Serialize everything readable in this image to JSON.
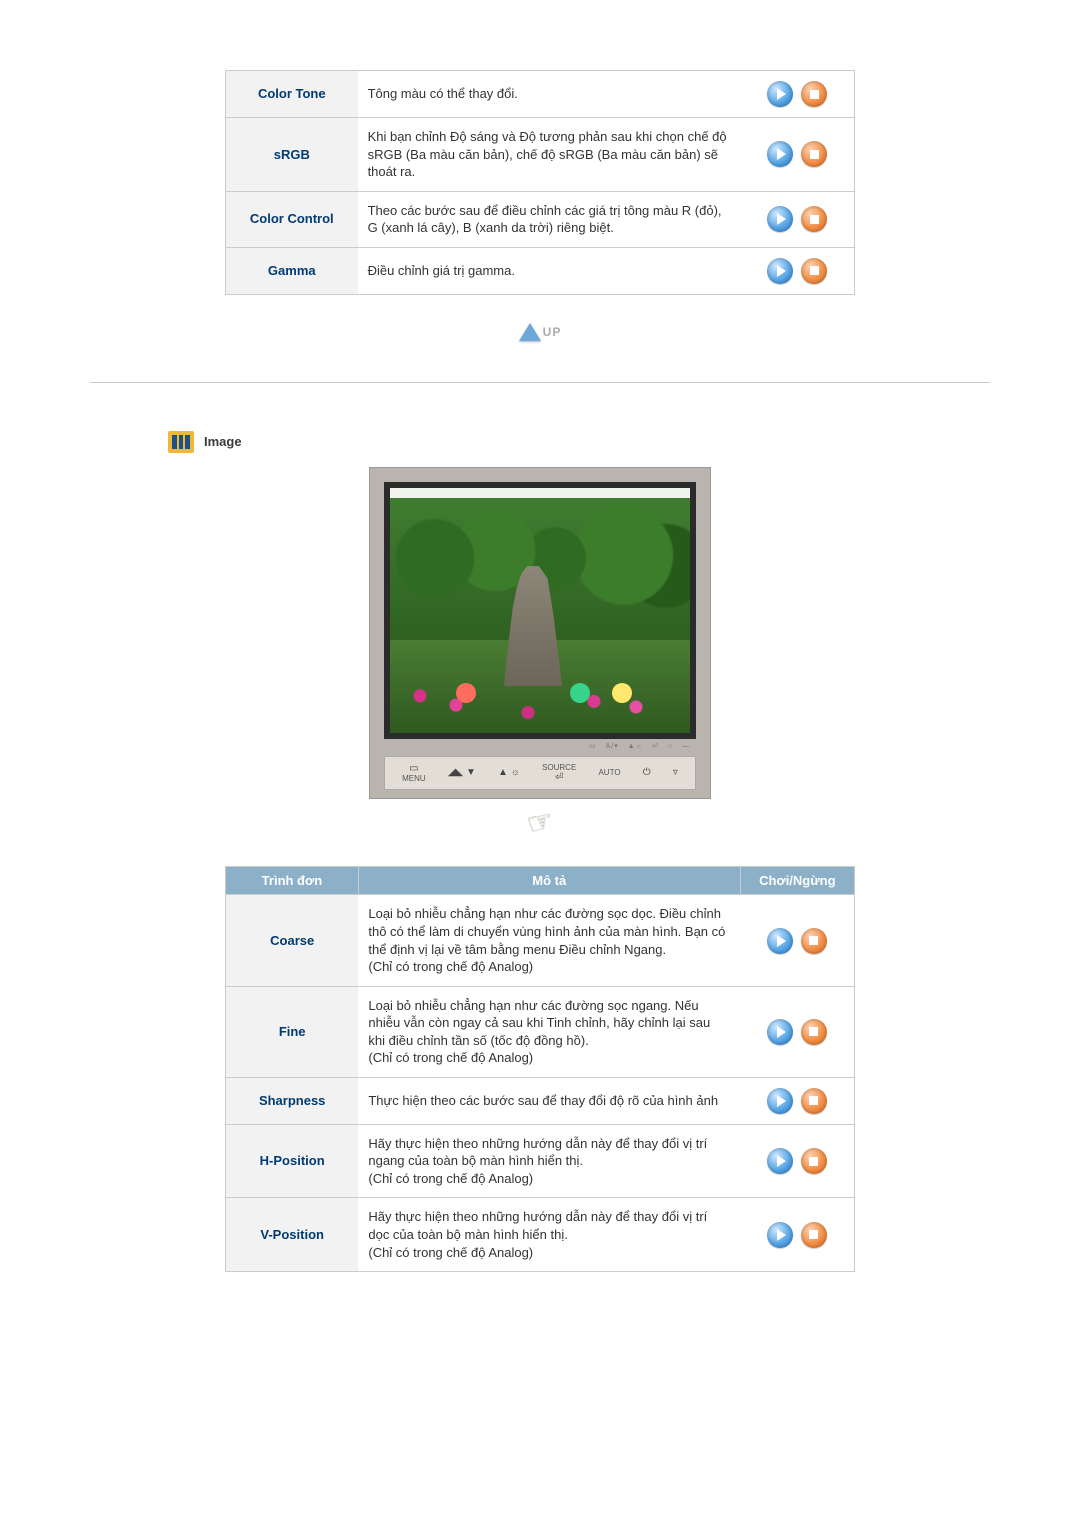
{
  "top_table": {
    "rows": [
      {
        "label": "Color Tone",
        "desc": "Tông màu có thể thay đổi."
      },
      {
        "label": "sRGB",
        "desc": "Khi bạn chỉnh Độ sáng và Độ tương phản sau khi chọn chế độ sRGB (Ba màu căn bản), chế độ sRGB (Ba màu căn bản) sẽ thoát ra."
      },
      {
        "label": "Color Control",
        "desc": "Theo các bước sau để điều chỉnh các giá trị tông màu R (đỏ), G (xanh lá cây), B (xanh da trời) riêng biệt."
      },
      {
        "label": "Gamma",
        "desc": "Điều chỉnh giá trị gamma."
      }
    ]
  },
  "up_label": "UP",
  "section_title": "Image",
  "monitor": {
    "indicator1": "▭",
    "indicator2": "A/▾",
    "indicator3": "▲☼",
    "indicator4": "⏎",
    "indicator5": "○",
    "indicator6": "—",
    "buttons": {
      "menu_sym": "▭",
      "menu": "MENU",
      "down_sym": "◢◣ ▼",
      "up_sym": "▲ ☼",
      "source_top": "SOURCE",
      "source_sym": "⏎",
      "auto": "AUTO",
      "power": "⏻",
      "misc": "▿"
    }
  },
  "image_table": {
    "headers": {
      "menu": "Trình đơn",
      "desc": "Mô tả",
      "play": "Chơi/Ngừng"
    },
    "rows": [
      {
        "label": "Coarse",
        "desc": "Loại bỏ nhiễu chẳng hạn như các đường sọc dọc. Điều chỉnh thô có thể làm di chuyển vùng hình ảnh của màn hình. Bạn có thể định vị lại về tâm bằng menu Điều chỉnh Ngang.\n(Chỉ có trong chế độ Analog)"
      },
      {
        "label": "Fine",
        "desc": "Loại bỏ nhiễu chẳng hạn như các đường sọc ngang. Nếu nhiễu vẫn còn ngay cả sau khi Tinh chỉnh, hãy chỉnh lại sau khi điều chỉnh tần số (tốc độ đồng hồ).\n(Chỉ có trong chế độ Analog)"
      },
      {
        "label": "Sharpness",
        "desc": "Thực hiện theo các bước sau để thay đổi độ rõ của hình ảnh"
      },
      {
        "label": "H-Position",
        "desc": "Hãy thực hiện theo những hướng dẫn này để thay đổi vị trí ngang của toàn bộ màn hình hiển thị.\n(Chỉ có trong chế độ Analog)"
      },
      {
        "label": "V-Position",
        "desc": "Hãy thực hiện theo những hướng dẫn này để thay đổi vị trí dọc của toàn bộ màn hình hiển thị.\n(Chỉ có trong chế độ Analog)"
      }
    ]
  }
}
